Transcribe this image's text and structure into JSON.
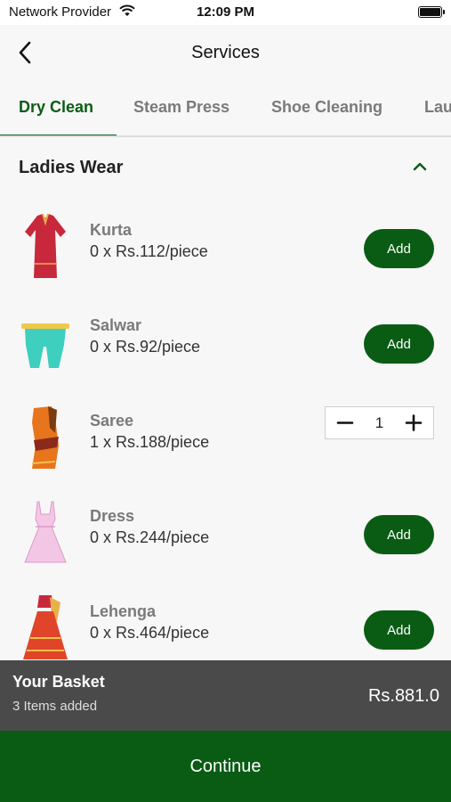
{
  "status_bar": {
    "carrier": "Network Provider",
    "time": "12:09 PM"
  },
  "nav": {
    "title": "Services"
  },
  "tabs": [
    {
      "label": "Dry Clean",
      "active": true
    },
    {
      "label": "Steam Press",
      "active": false
    },
    {
      "label": "Shoe Cleaning",
      "active": false
    },
    {
      "label": "Laundry",
      "active": false
    }
  ],
  "section": {
    "title": "Ladies Wear",
    "expanded": true
  },
  "items": [
    {
      "name": "Kurta",
      "price": "0 x Rs.112/piece",
      "action": "Add",
      "icon": "kurta-image"
    },
    {
      "name": "Salwar",
      "price": "0 x Rs.92/piece",
      "action": "Add",
      "icon": "salwar-image"
    },
    {
      "name": "Saree",
      "price": "1 x Rs.188/piece",
      "quantity": "1",
      "icon": "saree-image"
    },
    {
      "name": "Dress",
      "price": "0 x Rs.244/piece",
      "action": "Add",
      "icon": "dress-image"
    },
    {
      "name": "Lehenga",
      "price": "0 x Rs.464/piece",
      "action": "Add",
      "icon": "lehenga-image"
    }
  ],
  "basket": {
    "title": "Your Basket",
    "count": "3 Items added",
    "total": "Rs.881.0"
  },
  "continue_label": "Continue",
  "colors": {
    "brand": "#0a5c14",
    "basket_bg": "#4a4a4a",
    "muted": "#7a7a7a"
  }
}
